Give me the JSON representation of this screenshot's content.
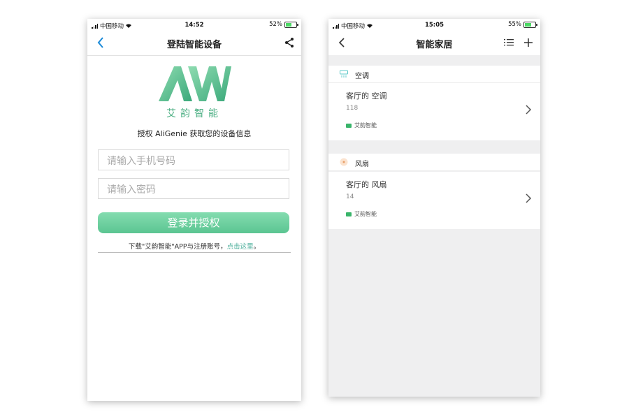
{
  "left": {
    "status": {
      "carrier": "中国移动",
      "time": "14:52",
      "battery": "52%"
    },
    "title": "登陆智能设备",
    "brand": "艾韵智能",
    "auth_text": "授权 AliGenie 获取您的设备信息",
    "phone_placeholder": "请输入手机号码",
    "password_placeholder": "请输入密码",
    "login_button": "登录并授权",
    "register_prefix": "下载\"艾韵智能\"APP与注册账号，",
    "register_link": "点击这里",
    "register_suffix": "。"
  },
  "right": {
    "status": {
      "carrier": "中国移动",
      "time": "15:05",
      "battery": "55%"
    },
    "title": "智能家居",
    "sections": [
      {
        "label": "空调",
        "device": {
          "name": "客厅的 空调",
          "id": "118",
          "brand": "艾韵智能"
        }
      },
      {
        "label": "风扇",
        "device": {
          "name": "客厅的 风扇",
          "id": "14",
          "brand": "艾韵智能"
        }
      }
    ]
  },
  "colors": {
    "accent": "#5bc592",
    "link": "#4aae9a",
    "ios_blue": "#1a8ad8"
  },
  "icons": [
    "back-chevron-icon",
    "share-icon",
    "list-icon",
    "plus-icon",
    "air-conditioner-icon",
    "fan-icon",
    "chevron-right-icon"
  ]
}
